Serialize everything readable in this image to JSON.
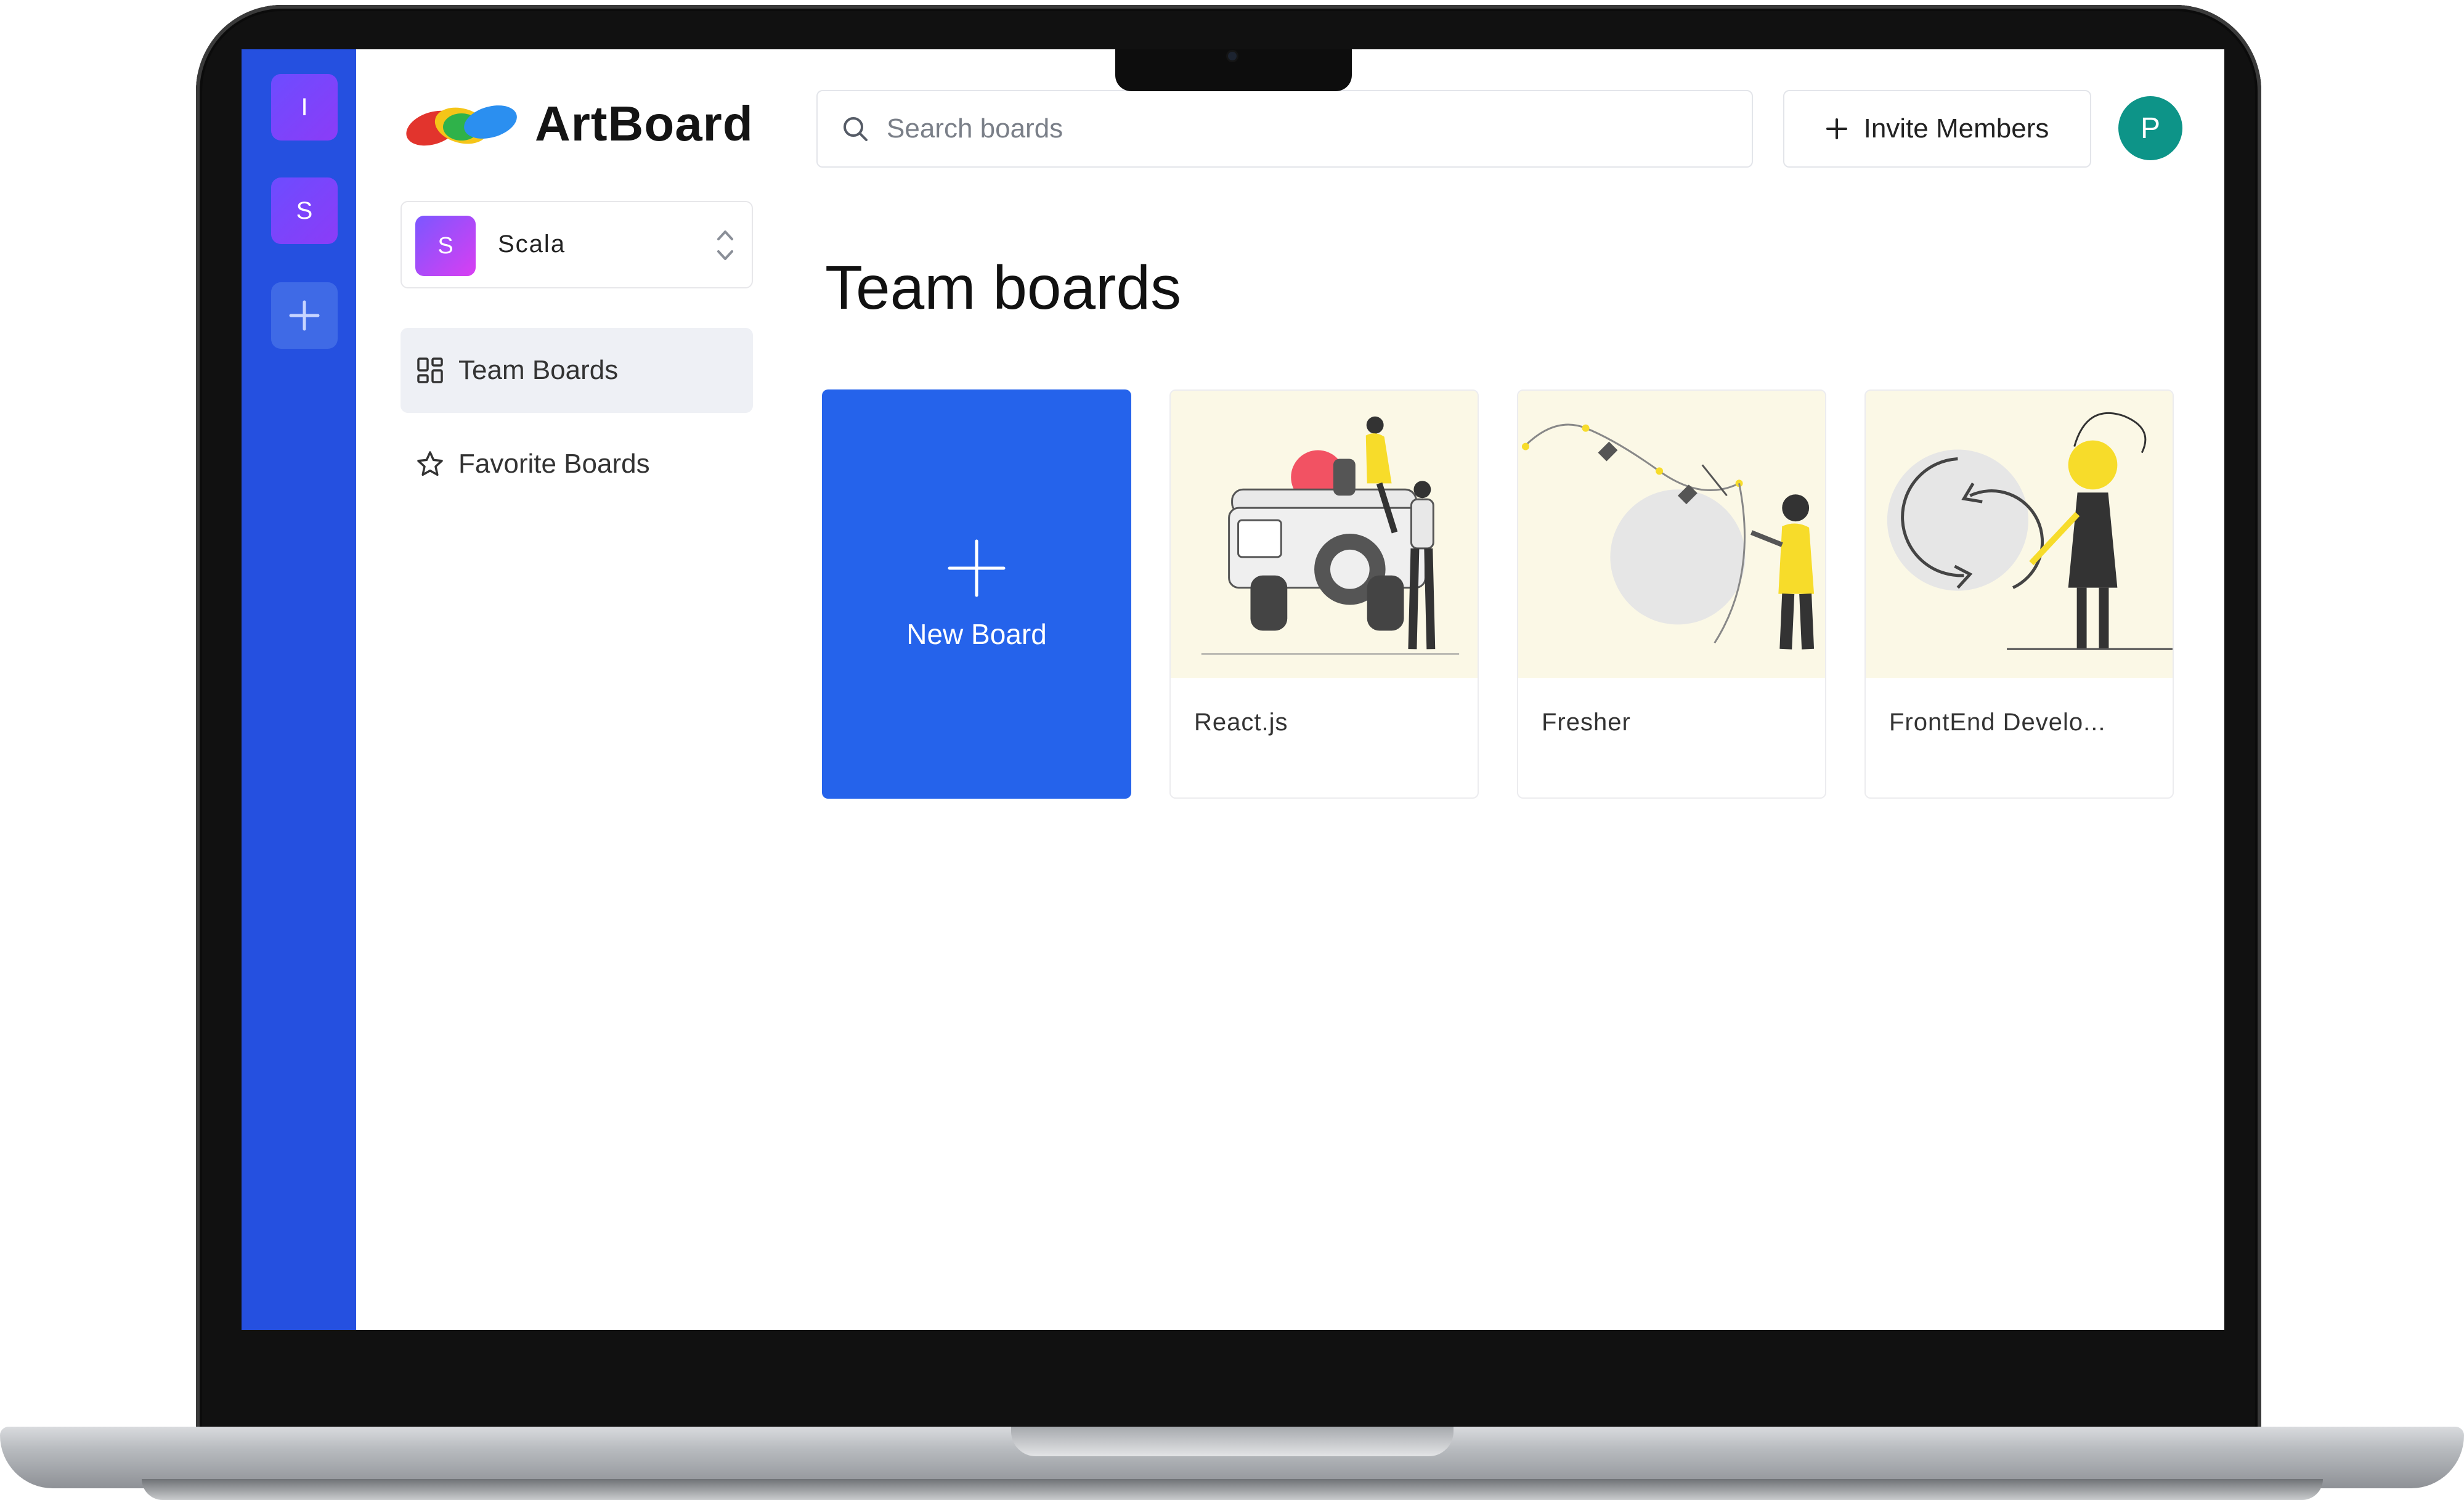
{
  "brand": {
    "name": "ArtBoard"
  },
  "workspaces": [
    {
      "initial": "I"
    },
    {
      "initial": "S"
    }
  ],
  "org": {
    "initial": "S",
    "name": "Scala"
  },
  "nav": [
    {
      "label": "Team Boards",
      "icon": "dashboard-grid-icon"
    },
    {
      "label": "Favorite Boards",
      "icon": "star-icon"
    }
  ],
  "search": {
    "placeholder": "Search boards",
    "value": ""
  },
  "invite": {
    "label": "Invite Members"
  },
  "user": {
    "initial": "P"
  },
  "page": {
    "title": "Team boards"
  },
  "new_board": {
    "label": "New Board"
  },
  "boards": [
    {
      "title": "React.js"
    },
    {
      "title": "Fresher"
    },
    {
      "title": "FrontEnd Develo..."
    }
  ],
  "colors": {
    "rail": "#2550e0",
    "new_board": "#2563eb",
    "avatar": "#0d9488",
    "illustration_yellow": "#f7dc2a",
    "illustration_bg": "#fbf8e6"
  }
}
